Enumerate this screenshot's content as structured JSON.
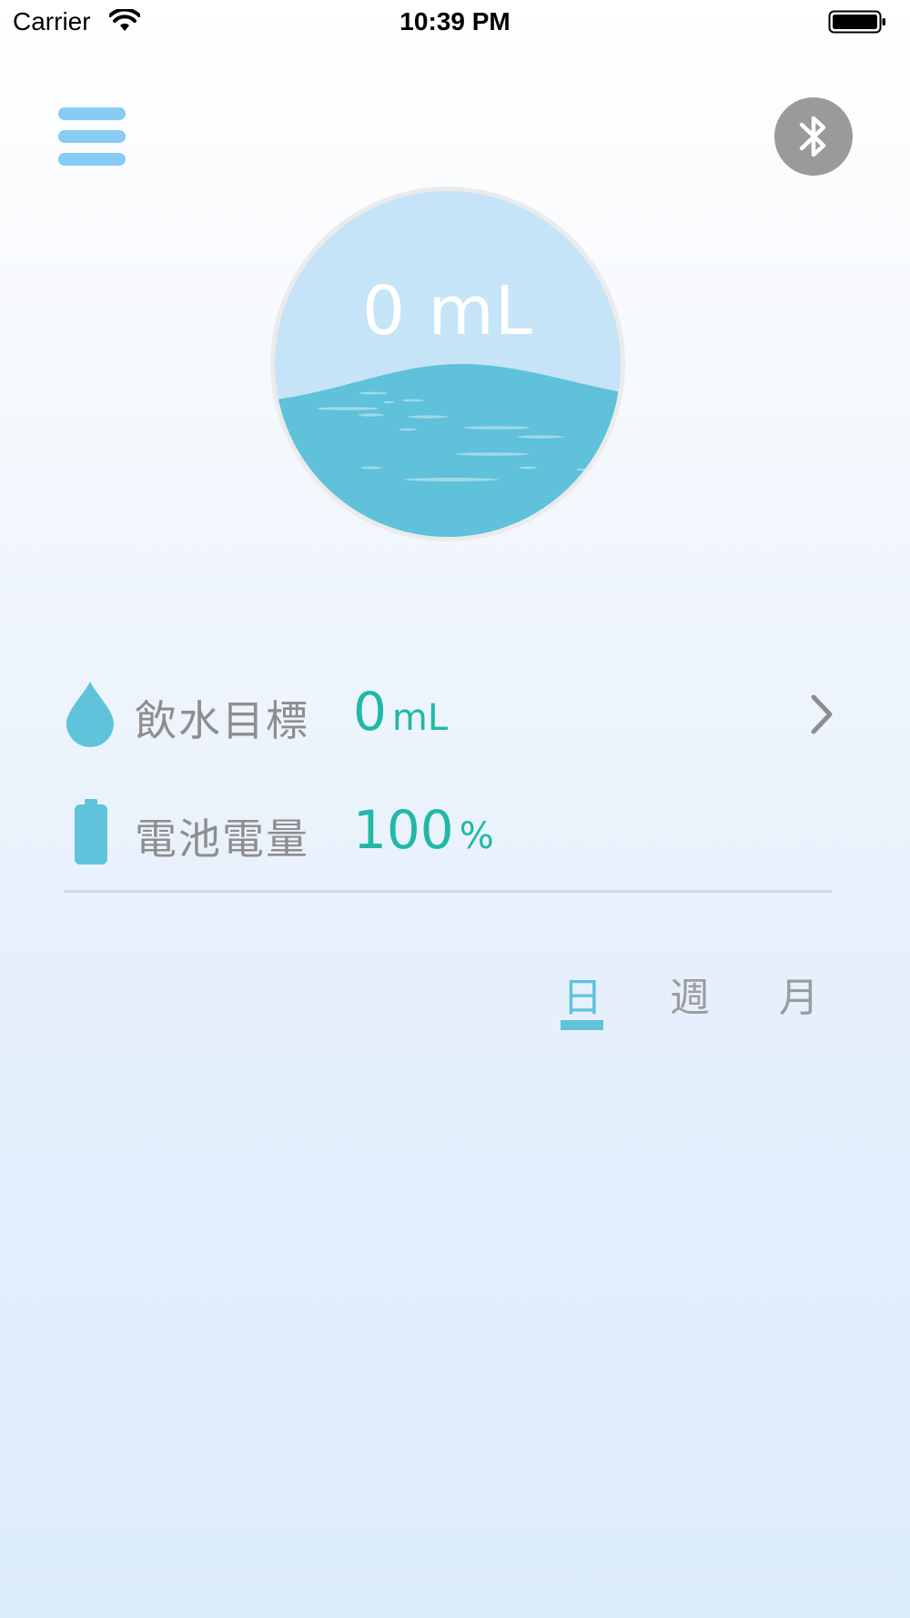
{
  "status_bar": {
    "carrier": "Carrier",
    "time": "10:39 PM",
    "icons": [
      "wifi-icon",
      "battery-icon"
    ]
  },
  "header": {
    "menu_icon": "hamburger-menu-icon",
    "bluetooth_icon": "bluetooth-icon"
  },
  "water": {
    "amount": "0 mL",
    "fill_fraction": 0.48
  },
  "goal": {
    "label": "飲水目標",
    "value": "0",
    "unit": "mL",
    "icon": "water-drop-icon"
  },
  "battery": {
    "label": "電池電量",
    "value": "100",
    "unit": "%",
    "icon": "battery-icon"
  },
  "tabs": [
    {
      "label": "日",
      "active": true
    },
    {
      "label": "週",
      "active": false
    },
    {
      "label": "月",
      "active": false
    }
  ],
  "colors": {
    "accent": "#5fc3db",
    "value_text": "#20b8a6",
    "menu": "#88cbf5",
    "water_light": "#c5e4f7",
    "water_dark": "#5fc1da"
  }
}
